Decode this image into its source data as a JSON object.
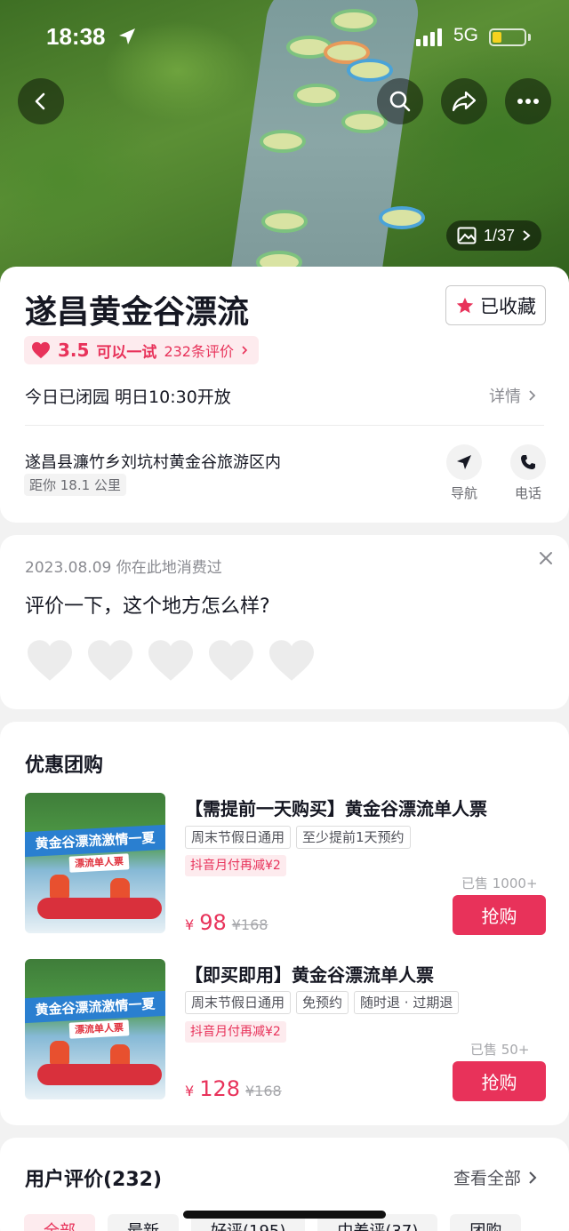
{
  "status_bar": {
    "time": "18:38",
    "network": "5G"
  },
  "hero": {
    "photo_counter": "1/37"
  },
  "poi": {
    "name": "遂昌黄金谷漂流",
    "favorite_label": "已收藏",
    "rating_score": "3.5",
    "rating_label": "可以一试",
    "review_count_label": "232条评价",
    "hours": "今日已闭园 明日10:30开放",
    "details_label": "详情",
    "address": "遂昌县濂竹乡刘坑村黄金谷旅游区内",
    "distance": "距你 18.1 公里",
    "nav_label": "导航",
    "phone_label": "电话"
  },
  "review_prompt": {
    "date_note": "2023.08.09 你在此地消费过",
    "question": "评价一下，这个地方怎么样?"
  },
  "deals": {
    "title": "优惠团购",
    "image_banner": "黄金谷漂流激情一夏",
    "image_sub": "漂流单人票",
    "items": [
      {
        "title": "【需提前一天购买】黄金谷漂流单人票",
        "tags": [
          "周末节假日通用",
          "至少提前1天预约"
        ],
        "promo": "抖音月付再减¥2",
        "sold": "已售 1000+",
        "currency": "¥",
        "price": "98",
        "original_price": "¥168",
        "buy_label": "抢购"
      },
      {
        "title": "【即买即用】黄金谷漂流单人票",
        "tags": [
          "周末节假日通用",
          "免预约",
          "随时退 · 过期退"
        ],
        "promo": "抖音月付再减¥2",
        "sold": "已售 50+",
        "currency": "¥",
        "price": "128",
        "original_price": "¥168",
        "buy_label": "抢购"
      }
    ]
  },
  "reviews": {
    "title": "用户评价(232)",
    "see_all": "查看全部",
    "filters": [
      "全部",
      "最新",
      "好评(195)",
      "中差评(37)",
      "团购"
    ]
  },
  "colors": {
    "accent": "#e8325a",
    "accent_bg": "#fdebee"
  }
}
